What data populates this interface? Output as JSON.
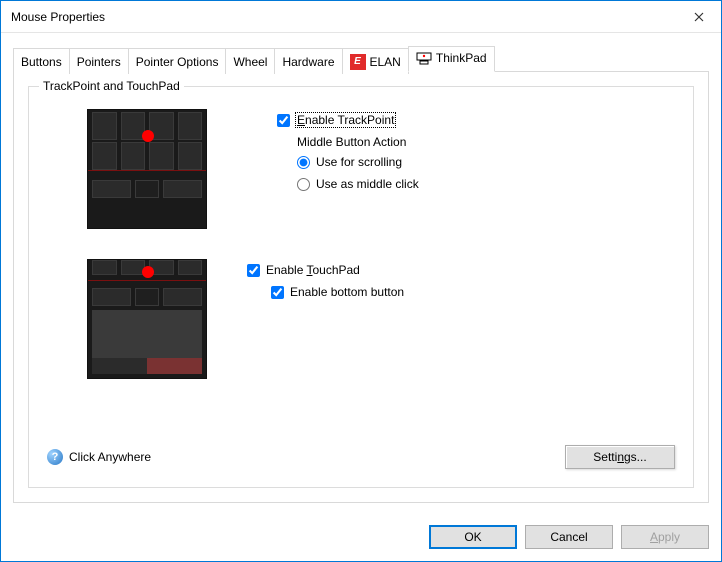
{
  "window": {
    "title": "Mouse Properties"
  },
  "tabs": {
    "buttons": "Buttons",
    "pointers": "Pointers",
    "pointer_options": "Pointer Options",
    "wheel": "Wheel",
    "hardware": "Hardware",
    "elan": "ELAN",
    "thinkpad": "ThinkPad"
  },
  "group": {
    "title": "TrackPoint and TouchPad"
  },
  "trackpoint": {
    "enable_prefix": "E",
    "enable_suffix": "nable TrackPoint",
    "middle_label": "Middle Button Action",
    "scroll": "Use for scrolling",
    "middle_click": "Use as middle click"
  },
  "touchpad": {
    "enable_prefix": "Enable ",
    "enable_u": "T",
    "enable_suffix": "ouchPad",
    "bottom": "Enable bottom button"
  },
  "help": {
    "label": "Click Anywhere"
  },
  "buttons": {
    "settings_prefix": "Setti",
    "settings_u": "n",
    "settings_suffix": "gs...",
    "ok": "OK",
    "cancel": "Cancel",
    "apply_u": "A",
    "apply_suffix": "pply"
  }
}
